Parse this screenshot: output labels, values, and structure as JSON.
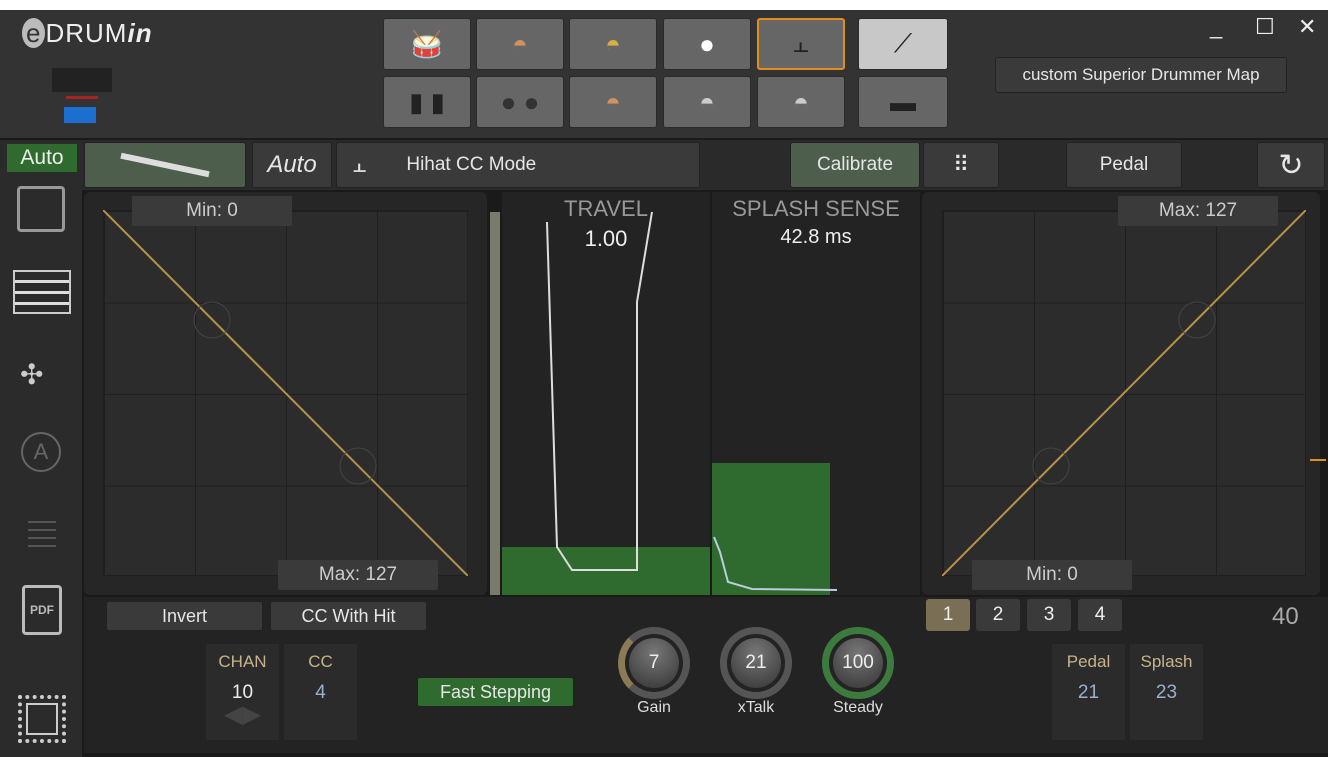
{
  "app": {
    "logo": "eDRUMin",
    "map_button": "custom Superior Drummer Map"
  },
  "window": {
    "minimize": "_",
    "maximize": "☐",
    "close": "✕"
  },
  "pads_top": [
    "snare",
    "crash",
    "ride",
    "kick",
    "hihat",
    "hihat-pedal"
  ],
  "pads_bottom": [
    "toms",
    "pads",
    "crash-2",
    "cymbal",
    "cymbal-2",
    "pedal-bar"
  ],
  "selected_pad": "hihat",
  "sidebar": {
    "auto": "Auto"
  },
  "toolbar": {
    "auto": "Auto",
    "mode": "Hihat CC Mode",
    "calibrate": "Calibrate",
    "pedal": "Pedal",
    "reset": "↻"
  },
  "left_graph": {
    "min": "Min: 0",
    "max": "Max: 127"
  },
  "right_graph": {
    "max": "Max: 127",
    "min": "Min: 0"
  },
  "travel": {
    "label": "TRAVEL",
    "value": "1.00"
  },
  "splash": {
    "label": "SPLASH SENSE",
    "value": "42.8 ms"
  },
  "bottom": {
    "invert": "Invert",
    "cc_with_hit": "CC With Hit",
    "fast_stepping": "Fast Stepping",
    "chan_label": "CHAN",
    "chan_value": "10",
    "cc_label": "CC",
    "cc_value": "4",
    "knobs": [
      {
        "label": "Gain",
        "value": "7"
      },
      {
        "label": "xTalk",
        "value": "21"
      },
      {
        "label": "Steady",
        "value": "100"
      }
    ],
    "pages": [
      "1",
      "2",
      "3",
      "4"
    ],
    "selected_page": "1",
    "readout": "40",
    "pedal_label": "Pedal",
    "pedal_value": "21",
    "splash_label": "Splash",
    "splash_value": "23"
  },
  "colors": {
    "accent": "#e0901a",
    "green": "#2f6b2f",
    "curve": "#b8924a"
  }
}
